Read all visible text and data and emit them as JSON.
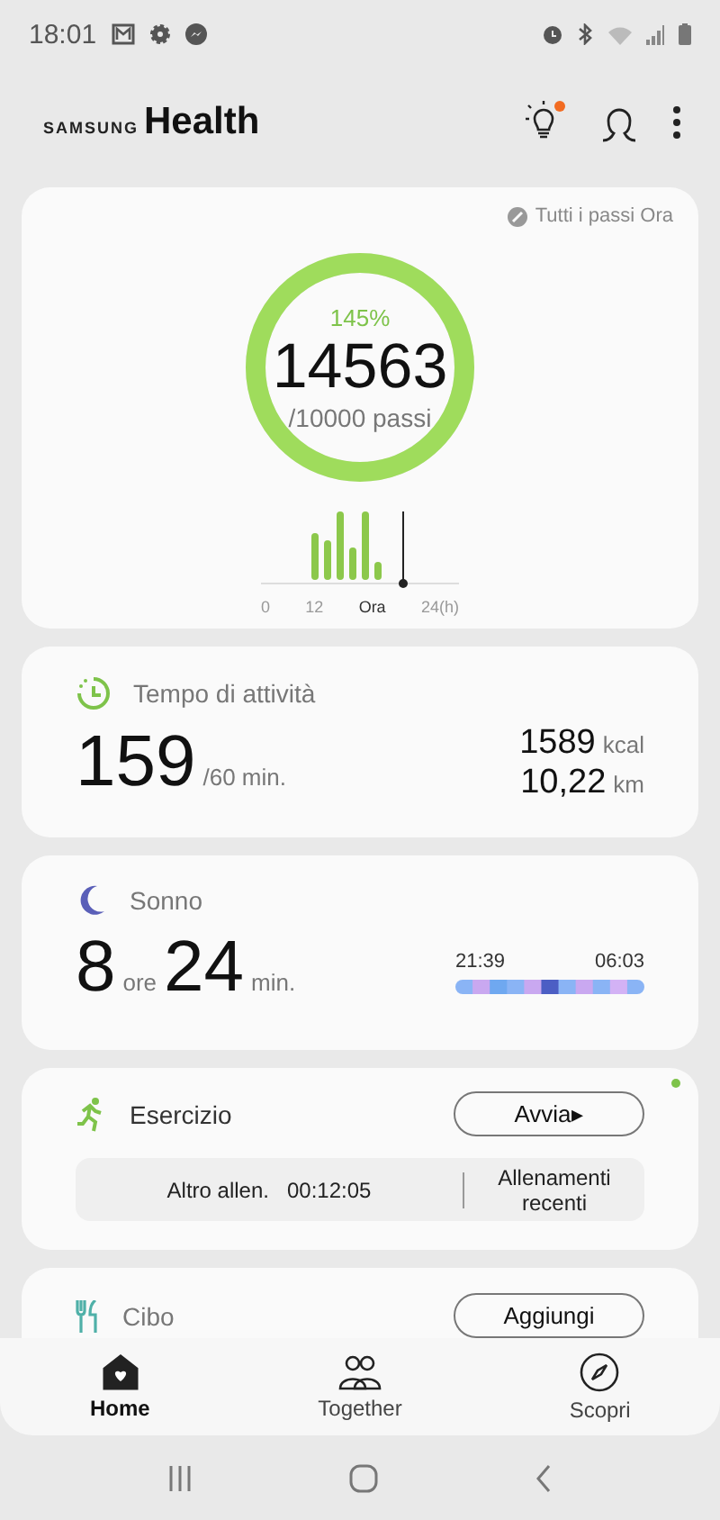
{
  "status_bar": {
    "time": "18:01"
  },
  "app_bar": {
    "logo_brand": "SAMSUNG",
    "logo_product": "Health",
    "tips_badge": true
  },
  "steps": {
    "link": "Tutti i passi Ora",
    "percent": "145%",
    "count": "14563",
    "goal": "/10000 passi",
    "axis_labels": [
      "0",
      "12",
      "Ora",
      "24(h)"
    ]
  },
  "activity": {
    "title": "Tempo di attività",
    "value": "159",
    "goal": "/60 min.",
    "calories": "1589",
    "calories_unit": "kcal",
    "distance": "10,22",
    "distance_unit": "km"
  },
  "sleep": {
    "title": "Sonno",
    "hours": "8",
    "hours_unit": "ore",
    "minutes": "24",
    "minutes_unit": "min.",
    "start": "21:39",
    "end": "06:03"
  },
  "exercise": {
    "title": "Esercizio",
    "button": "Avvia▸",
    "new_dot": true,
    "last_label": "Altro allen.",
    "last_time": "00:12:05",
    "recent": "Allenamenti recenti"
  },
  "food": {
    "title": "Cibo",
    "button": "Aggiungi"
  },
  "bottom_nav": [
    {
      "label": "Home",
      "selected": true,
      "kind": "home"
    },
    {
      "label": "Together",
      "selected": false,
      "kind": "together"
    },
    {
      "label": "Scopri",
      "selected": false,
      "kind": "discover"
    }
  ]
}
